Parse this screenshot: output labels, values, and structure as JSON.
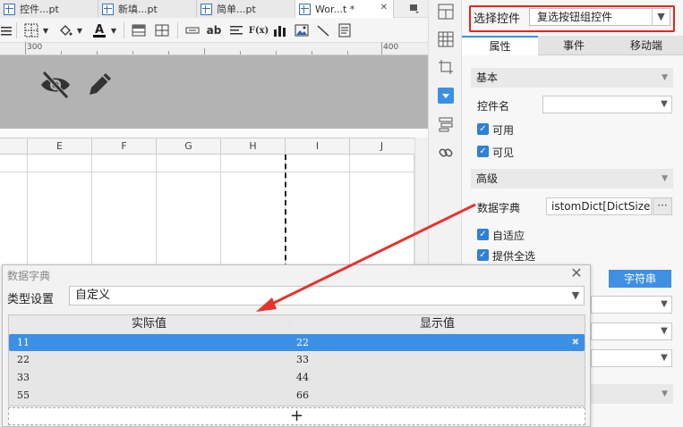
{
  "tabs": [
    {
      "label": "控件...pt"
    },
    {
      "label": "新填...pt"
    },
    {
      "label": "简单...pt"
    },
    {
      "label": "Wor...t *",
      "close": "✕"
    }
  ],
  "toolbar": {
    "text_button": "ab",
    "formula_button": "F(x)"
  },
  "ruler": {
    "labels": [
      "300",
      "400"
    ]
  },
  "columns": [
    "E",
    "F",
    "G",
    "H",
    "I",
    "J"
  ],
  "panel": {
    "control_label": "选择控件",
    "control_value": "复选按钮组控件",
    "tabs": [
      "属性",
      "事件",
      "移动端"
    ],
    "section_basic": "基本",
    "control_name_label": "控件名",
    "control_name_value": "",
    "enabled_label": "可用",
    "visible_label": "可见",
    "section_advanced": "高级",
    "dict_label": "数据字典",
    "dict_value": "istomDict[DictSize:4]",
    "dict_button": "···",
    "adaptive_label": "自适应",
    "select_all_label": "提供全选",
    "string_button": "字符串"
  },
  "dialog": {
    "title": "数据字典",
    "close": "✕",
    "type_label": "类型设置",
    "type_value": "自定义",
    "col_actual": "实际值",
    "col_display": "显示值",
    "rows": [
      {
        "actual": "11",
        "display": "22"
      },
      {
        "actual": "22",
        "display": "33"
      },
      {
        "actual": "33",
        "display": "44"
      },
      {
        "actual": "55",
        "display": "66"
      }
    ],
    "add": "+"
  },
  "colors": {
    "accent": "#3b90e5",
    "highlight_box": "#e8231e",
    "arrow": "#e8322b"
  }
}
